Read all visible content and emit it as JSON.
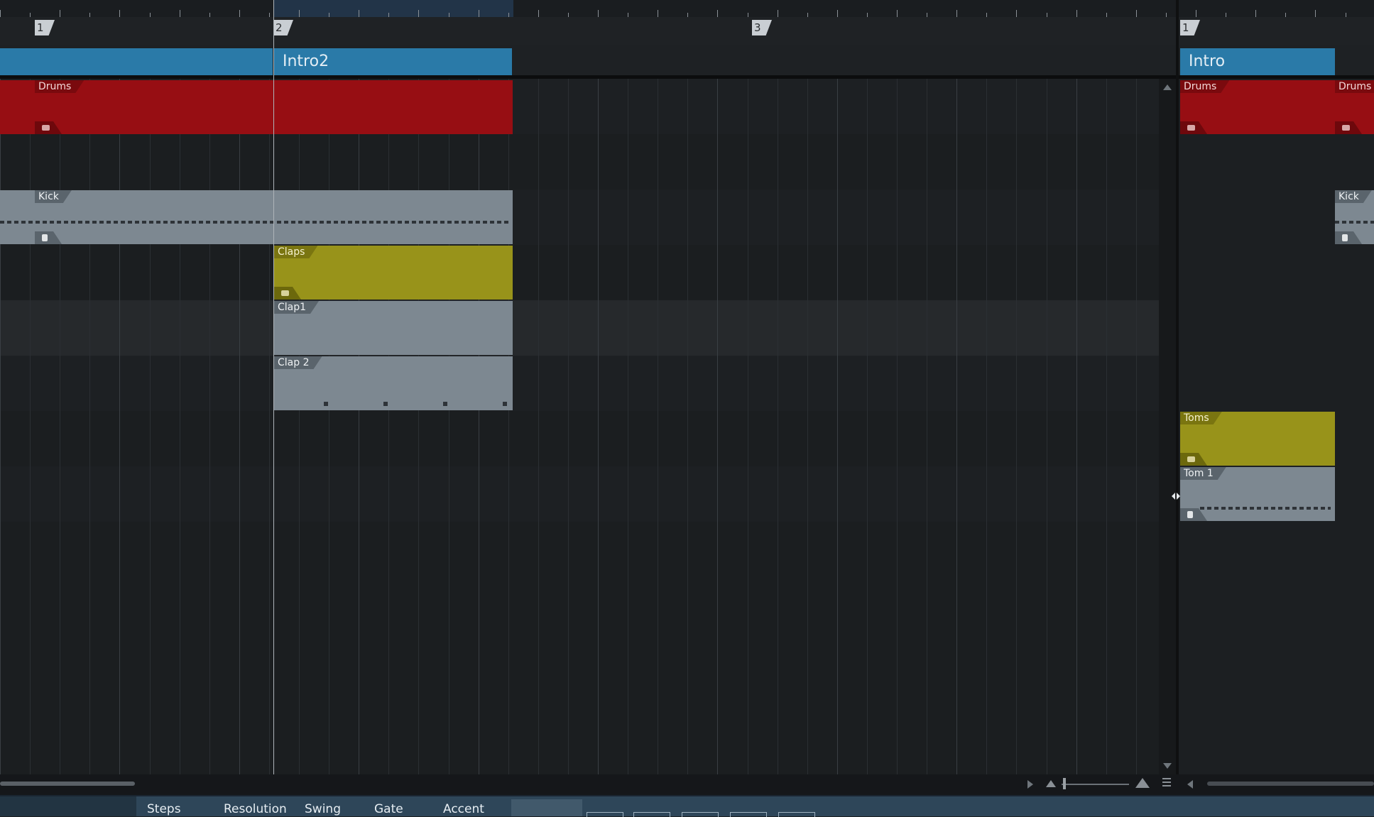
{
  "ruler": {
    "selection_color": "#223448"
  },
  "markers": [
    {
      "label": "1",
      "id": "marker-1-left"
    },
    {
      "label": "2",
      "id": "marker-2"
    },
    {
      "label": "3",
      "id": "marker-3"
    },
    {
      "label": "1",
      "id": "marker-1-right"
    }
  ],
  "arranger": {
    "sections": [
      {
        "label": ""
      },
      {
        "label": "Intro2"
      },
      {
        "label": "Intro"
      }
    ],
    "color": "#2a7aa8"
  },
  "patterns": {
    "drums_left": "Drums",
    "drums_right_1": "Drums",
    "drums_right_2": "Drums",
    "kick_left": "Kick",
    "kick_right": "Kick",
    "claps": "Claps",
    "clap1": "Clap1",
    "clap2": "Clap 2",
    "toms": "Toms",
    "tom1": "Tom 1"
  },
  "colors": {
    "drums": "#970e13",
    "note": "#7d8891",
    "claps": "#98931a"
  },
  "bottom_tabs": [
    "Steps",
    "Resolution",
    "Swing",
    "Gate",
    "Accent"
  ]
}
